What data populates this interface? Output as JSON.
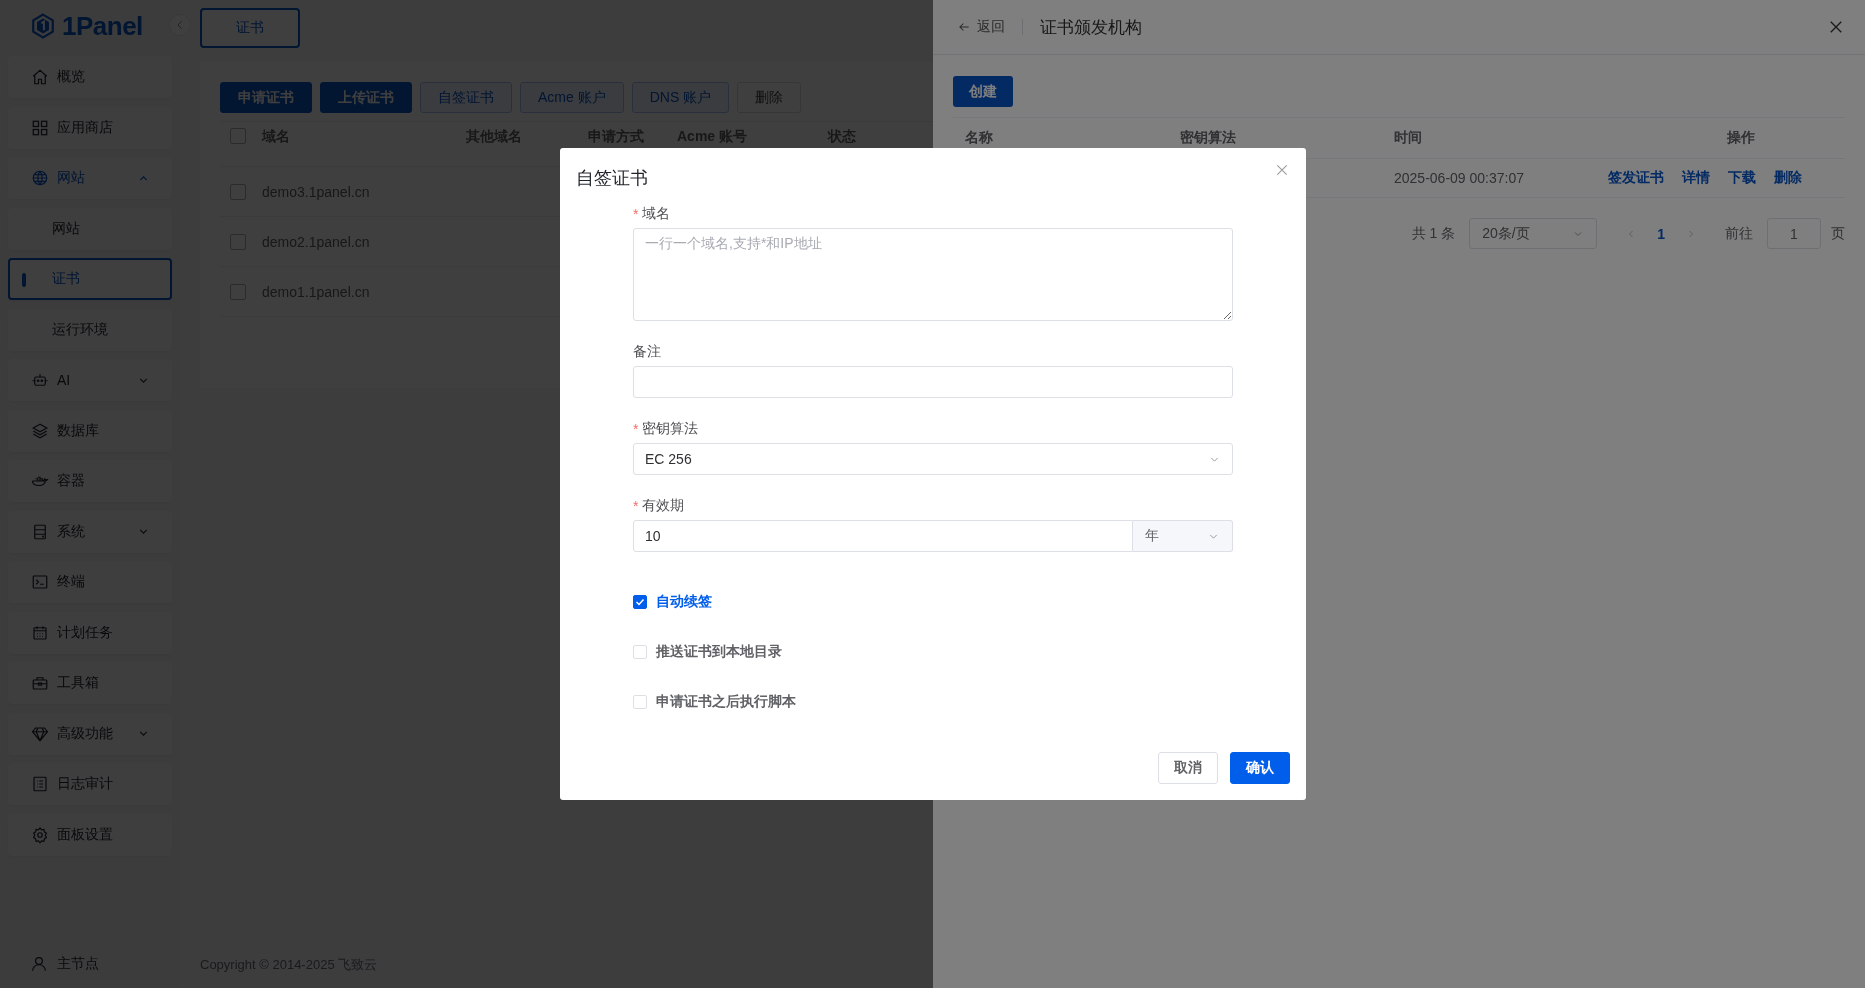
{
  "sidebar": {
    "logo": "1Panel",
    "items": [
      {
        "label": "概览",
        "selected": false
      },
      {
        "label": "应用商店",
        "selected": false
      },
      {
        "label": "网站",
        "selected": false,
        "expanded": true,
        "children": [
          {
            "label": "网站",
            "selected": false
          },
          {
            "label": "证书",
            "selected": true
          },
          {
            "label": "运行环境",
            "selected": false
          }
        ]
      },
      {
        "label": "AI",
        "selected": false,
        "expanded": false
      },
      {
        "label": "数据库",
        "selected": false
      },
      {
        "label": "容器",
        "selected": false
      },
      {
        "label": "系统",
        "selected": false,
        "expanded": false
      },
      {
        "label": "终端",
        "selected": false
      },
      {
        "label": "计划任务",
        "selected": false
      },
      {
        "label": "工具箱",
        "selected": false
      },
      {
        "label": "高级功能",
        "selected": false,
        "expanded": false
      },
      {
        "label": "日志审计",
        "selected": false
      },
      {
        "label": "面板设置",
        "selected": false
      }
    ],
    "node": "主节点"
  },
  "main": {
    "tab": "证书",
    "toolbar": [
      {
        "label": "申请证书",
        "kind": "primary"
      },
      {
        "label": "上传证书",
        "kind": "primary"
      },
      {
        "label": "自签证书",
        "kind": "plain"
      },
      {
        "label": "Acme 账户",
        "kind": "plain"
      },
      {
        "label": "DNS 账户",
        "kind": "plain"
      },
      {
        "label": "删除",
        "kind": "disabled"
      }
    ],
    "table": {
      "all_checked": false,
      "columns": [
        "域名",
        "其他域名",
        "申请方式",
        "Acme 账号",
        "状态"
      ],
      "rows": [
        {
          "checked": false,
          "domain": "demo3.1panel.cn"
        },
        {
          "checked": false,
          "domain": "demo2.1panel.cn"
        },
        {
          "checked": false,
          "domain": "demo1.1panel.cn"
        }
      ]
    },
    "footer": "Copyright © 2014-2025 飞致云"
  },
  "drawer": {
    "back": "返回",
    "title": "证书颁发机构",
    "create": "创建",
    "columns": [
      "名称",
      "密钥算法",
      "时间",
      "操作"
    ],
    "rows": [
      {
        "time": "2025-06-09 00:37:07",
        "actions": [
          "签发证书",
          "详情",
          "下载",
          "删除"
        ]
      }
    ],
    "pagination": {
      "total": "共 1 条",
      "page_size": "20条/页",
      "pages": [
        {
          "label": "1",
          "selected": true
        }
      ],
      "goto": "前往",
      "goto_value": "1",
      "suffix": "页"
    }
  },
  "dialog": {
    "title": "自签证书",
    "required_mark": "*",
    "fields": [
      {
        "kind": "textarea",
        "label": "域名",
        "required": true,
        "placeholder": "一行一个域名,支持*和IP地址"
      },
      {
        "kind": "text",
        "label": "备注",
        "required": false
      },
      {
        "kind": "select",
        "label": "密钥算法",
        "required": true,
        "value": "EC 256"
      },
      {
        "kind": "duration",
        "label": "有效期",
        "required": true,
        "value": "10",
        "unit": "年"
      }
    ],
    "checkboxes": [
      {
        "label": "自动续签",
        "checked": true
      },
      {
        "label": "推送证书到本地目录",
        "checked": false
      },
      {
        "label": "申请证书之后执行脚本",
        "checked": false
      }
    ],
    "cancel": "取消",
    "confirm": "确认"
  }
}
